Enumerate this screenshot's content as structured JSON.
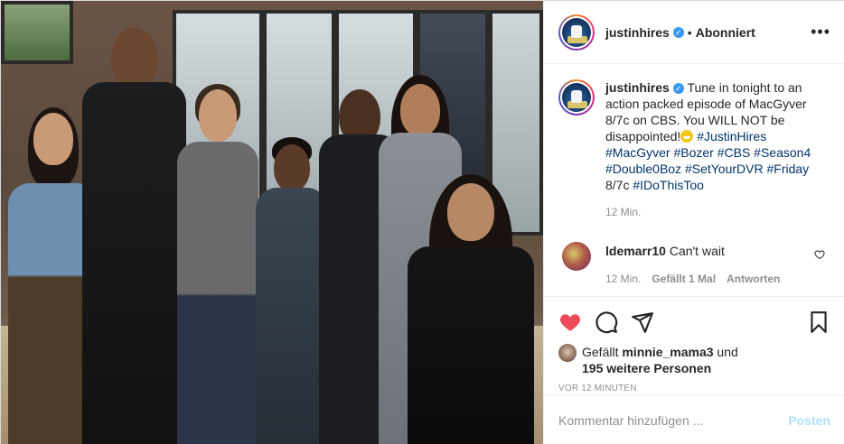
{
  "header": {
    "username": "justinhires",
    "separator": "•",
    "follow_status": "Abonniert",
    "more_label": "•••"
  },
  "caption": {
    "username": "justinhires",
    "text_before_emoji": "Tune in tonight to an action packed episode of MacGyver 8/7c on CBS. You WILL NOT be disappointed!",
    "hashtags_line1": "#JustinHires",
    "hashtags_line2": "#MacGyver #Bozer #CBS #Season4",
    "hashtags_line3": "#Double0Boz #SetYourDVR #Friday",
    "text_after": "8/7c",
    "hashtag_last": "#IDoThisToo",
    "time": "12 Min."
  },
  "comment": {
    "username": "ldemarr10",
    "text": "Can't wait",
    "time": "12 Min.",
    "likes": "Gefällt 1 Mal",
    "reply": "Antworten"
  },
  "likes": {
    "prefix": "Gefällt",
    "user": "minnie_mama3",
    "joiner": "und",
    "others": "195 weitere Personen"
  },
  "timestamp": "VOR 12 MINUTEN",
  "add_comment": {
    "placeholder": "Kommentar hinzufügen ...",
    "post_label": "Posten"
  },
  "icons": {
    "like": "heart-icon",
    "comment": "comment-icon",
    "share": "share-icon",
    "save": "bookmark-icon",
    "more": "more-options-icon"
  },
  "colors": {
    "like_red": "#ed4956",
    "link_blue": "#003569",
    "verified_blue": "#3897f0",
    "post_disabled": "#b2dffc",
    "muted": "#8e8e8e"
  }
}
